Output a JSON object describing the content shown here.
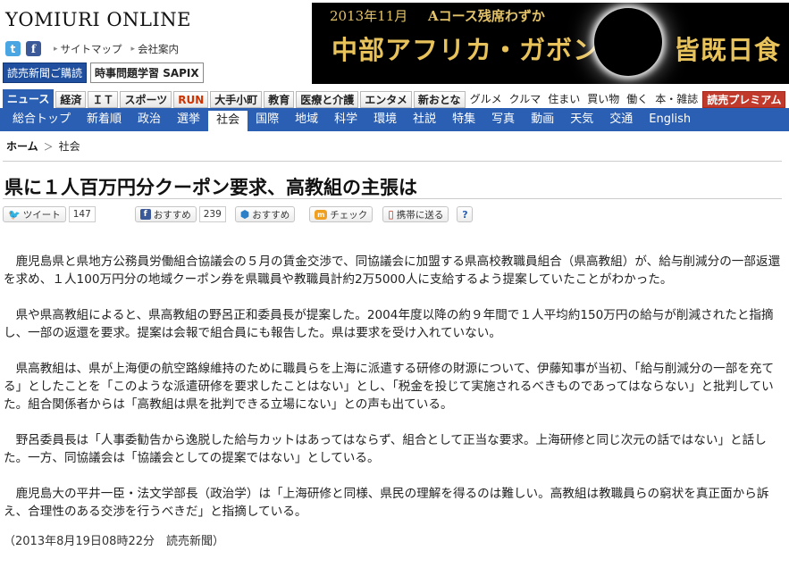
{
  "header": {
    "logo": "YOMIURI ONLINE",
    "links": [
      "サイトマップ",
      "会社案内"
    ],
    "subscribe": "読売新聞ご購読",
    "study": "時事問題学習 SAPIX",
    "social_icons": [
      "twitter-icon",
      "facebook-icon"
    ]
  },
  "banner": {
    "date": "2013年11月",
    "note": "Aコース残席わずか",
    "main": "中部アフリカ・ガボン",
    "right": "皆既日食"
  },
  "categories": [
    {
      "label": "ニュース",
      "style": "active"
    },
    {
      "label": "経済",
      "style": "tab"
    },
    {
      "label": "ＩＴ",
      "style": "tab"
    },
    {
      "label": "スポーツ",
      "style": "tab"
    },
    {
      "label": "RUN",
      "style": "run"
    },
    {
      "label": "大手小町",
      "style": "tab"
    },
    {
      "label": "教育",
      "style": "tab"
    },
    {
      "label": "医療と介護",
      "style": "tab"
    },
    {
      "label": "エンタメ",
      "style": "tab"
    },
    {
      "label": "新おとな",
      "style": "tab"
    },
    {
      "label": "グルメ",
      "style": "plain"
    },
    {
      "label": "クルマ",
      "style": "plain"
    },
    {
      "label": "住まい",
      "style": "plain"
    },
    {
      "label": "買い物",
      "style": "plain"
    },
    {
      "label": "働く",
      "style": "plain"
    },
    {
      "label": "本・雑誌",
      "style": "plain"
    },
    {
      "label": "読売プレミアム",
      "style": "premium"
    }
  ],
  "subnav": [
    {
      "label": "総合トップ"
    },
    {
      "label": "新着順"
    },
    {
      "label": "政治"
    },
    {
      "label": "選挙"
    },
    {
      "label": "社会",
      "active": true
    },
    {
      "label": "国際"
    },
    {
      "label": "地域"
    },
    {
      "label": "科学"
    },
    {
      "label": "環境"
    },
    {
      "label": "社説"
    },
    {
      "label": "特集"
    },
    {
      "label": "写真"
    },
    {
      "label": "動画"
    },
    {
      "label": "天気"
    },
    {
      "label": "交通"
    },
    {
      "label": "English"
    }
  ],
  "breadcrumb": {
    "home": "ホーム",
    "sep": "＞",
    "current": "社会"
  },
  "article": {
    "title": "県に１人百万円分クーポン要求、高教組の主張は",
    "paragraphs": [
      "鹿児島県と県地方公務員労働組合協議会の５月の賃金交渉で、同協議会に加盟する県高校教職員組合（県高教組）が、給与削減分の一部返還を求め、１人100万円分の地域クーポン券を県職員や教職員計約2万5000人に支給するよう提案していたことがわかった。",
      "県や県高教組によると、県高教組の野呂正和委員長が提案した。2004年度以降の約９年間で１人平均約150万円の給与が削減されたと指摘し、一部の返還を要求。提案は会報で組合員にも報告した。県は要求を受け入れていない。",
      "県高教組は、県が上海便の航空路線維持のために職員らを上海に派遣する研修の財源について、伊藤知事が当初、「給与削減分の一部を充てる」としたことを「このような派遣研修を要求したことはない」とし、「税金を投じて実施されるべきものであってはならない」と批判していた。組合関係者からは「高教組は県を批判できる立場にない」との声も出ている。",
      "野呂委員長は「人事委勧告から逸脱した給与カットはあってはならず、組合として正当な要求。上海研修と同じ次元の話ではない」と話した。一方、同協議会は「協議会としての提案ではない」としている。",
      "鹿児島大の平井一臣・法文学部長（政治学）は「上海研修と同様、県民の理解を得るのは難しい。高教組は教職員らの窮状を真正面から訴え、合理性のある交渉を行うべきだ」と指摘している。"
    ],
    "dateline": "（2013年8月19日08時22分　読売新聞）"
  },
  "share": {
    "tweet": "ツイート",
    "tweet_count": "147",
    "fb_recommend": "おすすめ",
    "fb_count": "239",
    "recommend2": "おすすめ",
    "mixi_check": "チェック",
    "mobile": "携帯に送る",
    "help": "?"
  }
}
